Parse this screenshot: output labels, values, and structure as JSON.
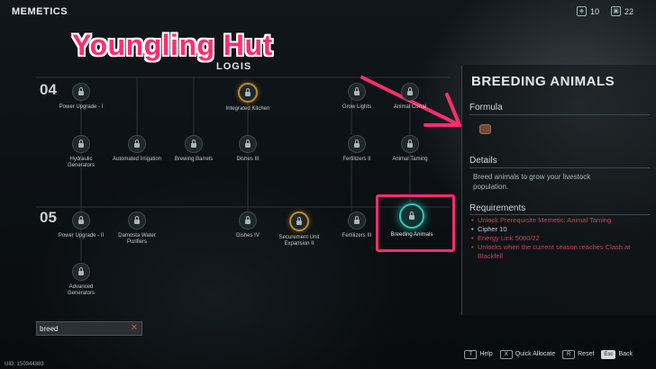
{
  "header": {
    "title": "MEMETICS",
    "resources": [
      {
        "icon": "chip-icon",
        "value": "10"
      },
      {
        "icon": "energy-icon",
        "value": "22"
      }
    ]
  },
  "annotation": {
    "banner": "Youngling Hut"
  },
  "tree": {
    "section_title": "LOGIS",
    "row_labels": [
      "04",
      "05"
    ],
    "nodes": {
      "power_upgrade_1": "Power Upgrade - I",
      "integrated_kitchen": "Integrated Kitchen",
      "grow_lights": "Grow Lights",
      "animal_corral": "Animal Corral",
      "hydraulic_generators": "Hydraulic Generators",
      "automated_irrigation": "Automated Irrigation",
      "brewing_barrels": "Brewing Barrels",
      "dishes_3": "Dishes III",
      "fertilizers_2": "Fertilizers II",
      "animal_taming": "Animal Taming",
      "power_upgrade_2": "Power Upgrade - II",
      "damosta_water_purifiers": "Damosta Water Purifiers",
      "dishes_4": "Dishes IV",
      "securement_unit_expansion_2": "Securement Unit Expansion II",
      "fertilizers_3": "Fertilizers III",
      "breeding_animals": "Breeding Animals",
      "advanced_generators": "Advanced Generators"
    }
  },
  "detail": {
    "title": "BREEDING ANIMALS",
    "formula_label": "Formula",
    "details_label": "Details",
    "description": "Breed animals to grow your livestock population.",
    "requirements_label": "Requirements",
    "requirements": [
      {
        "text": "Unlock Prerequisite Memetic: Animal Taming",
        "met": false
      },
      {
        "text": "Cipher 10",
        "met": true
      },
      {
        "text": "Energy Link 5000/22",
        "met": false
      },
      {
        "text": "Unlocks when the current season reaches Clash at Blackfell",
        "met": false
      }
    ]
  },
  "search": {
    "value": "breed"
  },
  "footer": {
    "uid": "UID: 150344883",
    "hints": [
      {
        "key": "T",
        "label": "Help"
      },
      {
        "key": "X",
        "label": "Quick Allocate"
      },
      {
        "key": "R",
        "label": "Reset"
      },
      {
        "key": "Esc",
        "label": "Back"
      }
    ]
  },
  "colors": {
    "accent": "#ff2d6f",
    "selected_ring": "#2fc7b7",
    "unlocked_ring": "#b98a2e",
    "requirement_unmet": "#c9455f"
  }
}
